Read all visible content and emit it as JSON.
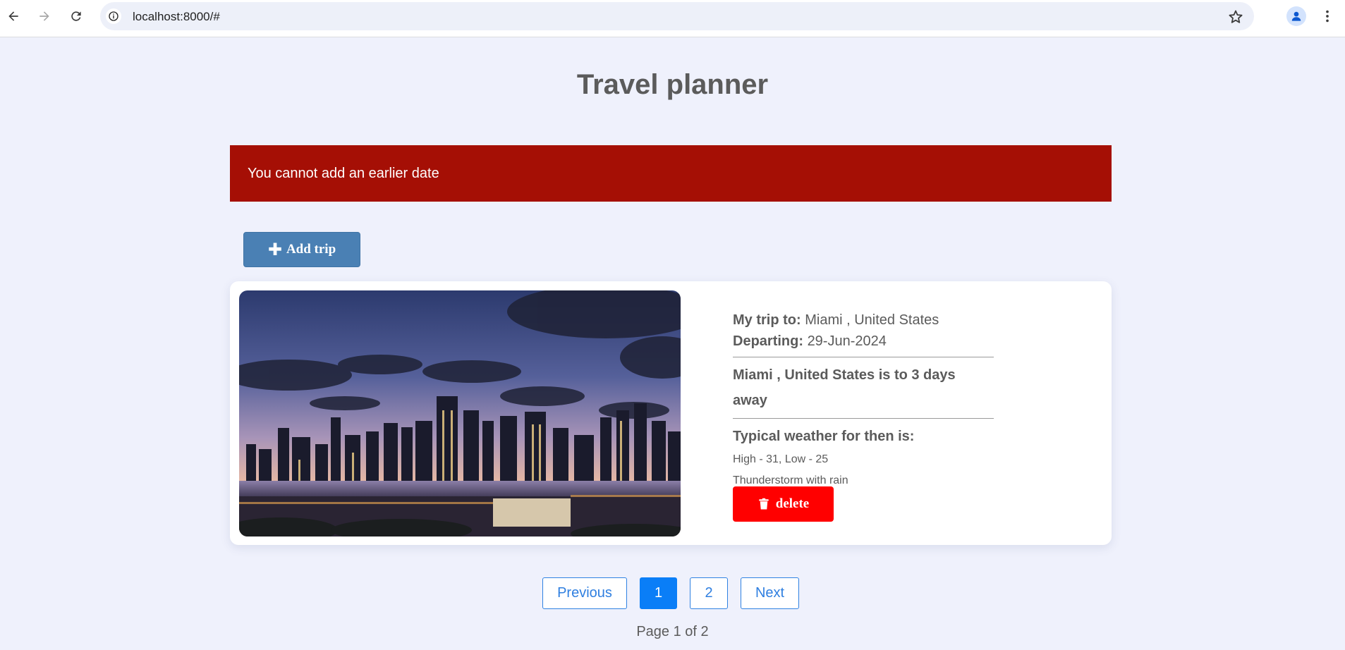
{
  "browser": {
    "url": "localhost:8000/#"
  },
  "page": {
    "title": "Travel planner"
  },
  "alert": {
    "message": "You cannot add an earlier date"
  },
  "toolbar": {
    "add_trip_label": "Add trip"
  },
  "trip": {
    "destination_label": "My trip to:",
    "destination": "Miami , United States",
    "departing_label": "Departing:",
    "departing": "29-Jun-2024",
    "countdown": "Miami , United States is to 3 days away",
    "weather_title": "Typical weather for then is:",
    "temperature": "High - 31, Low - 25",
    "conditions": "Thunderstorm with rain",
    "delete_label": "delete"
  },
  "pagination": {
    "previous_label": "Previous",
    "pages": [
      "1",
      "2"
    ],
    "current_page": "1",
    "next_label": "Next",
    "status": "Page 1 of 2"
  },
  "colors": {
    "background": "#eff1fc",
    "alert": "#a50f05",
    "add_button": "#4a80b4",
    "delete_button": "#ff0000",
    "page_active": "#0a7ef7"
  }
}
